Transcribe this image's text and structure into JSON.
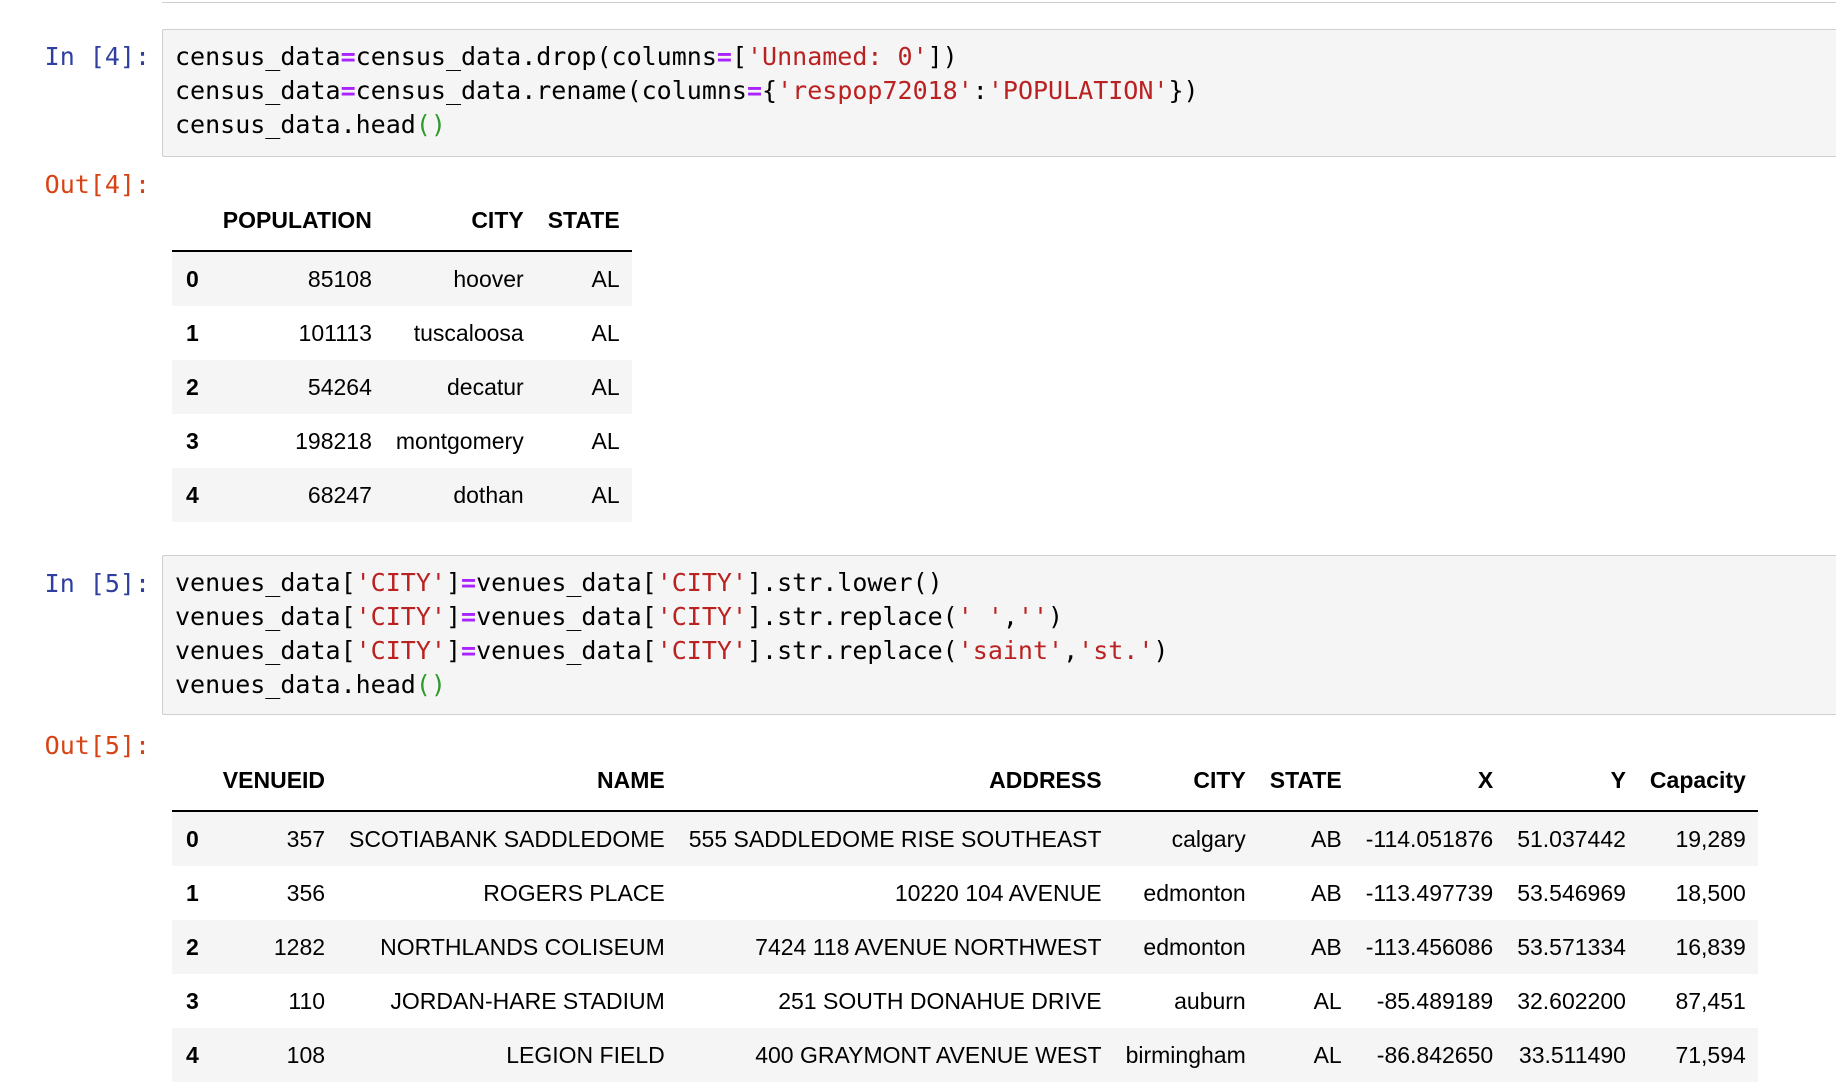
{
  "cell4": {
    "in_prompt": "In [4]:",
    "code": [
      [
        [
          "census_data",
          ""
        ],
        [
          "=",
          "op"
        ],
        [
          "census_data.drop(columns",
          ""
        ],
        [
          "=",
          "op"
        ],
        [
          "[",
          ""
        ],
        [
          "'Unnamed: 0'",
          "str"
        ],
        [
          "])",
          ""
        ]
      ],
      [
        [
          "census_data",
          ""
        ],
        [
          "=",
          "op"
        ],
        [
          "census_data.rename(columns",
          ""
        ],
        [
          "=",
          "op"
        ],
        [
          "{",
          ""
        ],
        [
          "'respop72018'",
          "str"
        ],
        [
          ":",
          ""
        ],
        [
          "'POPULATION'",
          "str"
        ],
        [
          "})",
          ""
        ]
      ],
      [
        [
          "census_data.head",
          ""
        ],
        [
          "()",
          "paren"
        ]
      ]
    ],
    "out_prompt": "Out[4]:",
    "table": {
      "columns": [
        "POPULATION",
        "CITY",
        "STATE"
      ],
      "rows": [
        {
          "index": "0",
          "cells": [
            "85108",
            "hoover",
            "AL"
          ]
        },
        {
          "index": "1",
          "cells": [
            "101113",
            "tuscaloosa",
            "AL"
          ]
        },
        {
          "index": "2",
          "cells": [
            "54264",
            "decatur",
            "AL"
          ]
        },
        {
          "index": "3",
          "cells": [
            "198218",
            "montgomery",
            "AL"
          ]
        },
        {
          "index": "4",
          "cells": [
            "68247",
            "dothan",
            "AL"
          ]
        }
      ]
    }
  },
  "cell5": {
    "in_prompt": "In [5]:",
    "code": [
      [
        [
          "venues_data[",
          ""
        ],
        [
          "'CITY'",
          "str"
        ],
        [
          "]",
          ""
        ],
        [
          "=",
          "op"
        ],
        [
          "venues_data[",
          ""
        ],
        [
          "'CITY'",
          "str"
        ],
        [
          "].str.lower()",
          ""
        ]
      ],
      [
        [
          "venues_data[",
          ""
        ],
        [
          "'CITY'",
          "str"
        ],
        [
          "]",
          ""
        ],
        [
          "=",
          "op"
        ],
        [
          "venues_data[",
          ""
        ],
        [
          "'CITY'",
          "str"
        ],
        [
          "].str.replace(",
          ""
        ],
        [
          "' '",
          "str"
        ],
        [
          ",",
          ""
        ],
        [
          "''",
          "str"
        ],
        [
          ")",
          ""
        ]
      ],
      [
        [
          "venues_data[",
          ""
        ],
        [
          "'CITY'",
          "str"
        ],
        [
          "]",
          ""
        ],
        [
          "=",
          "op"
        ],
        [
          "venues_data[",
          ""
        ],
        [
          "'CITY'",
          "str"
        ],
        [
          "].str.replace(",
          ""
        ],
        [
          "'saint'",
          "str"
        ],
        [
          ",",
          ""
        ],
        [
          "'st.'",
          "str"
        ],
        [
          ")",
          ""
        ]
      ],
      [
        [
          "venues_data.head",
          ""
        ],
        [
          "()",
          "paren"
        ]
      ]
    ],
    "out_prompt": "Out[5]:",
    "table": {
      "columns": [
        "VENUEID",
        "NAME",
        "ADDRESS",
        "CITY",
        "STATE",
        "X",
        "Y",
        "Capacity"
      ],
      "rows": [
        {
          "index": "0",
          "cells": [
            "357",
            "SCOTIABANK SADDLEDOME",
            "555 SADDLEDOME RISE SOUTHEAST",
            "calgary",
            "AB",
            "-114.051876",
            "51.037442",
            "19,289"
          ]
        },
        {
          "index": "1",
          "cells": [
            "356",
            "ROGERS PLACE",
            "10220 104 AVENUE",
            "edmonton",
            "AB",
            "-113.497739",
            "53.546969",
            "18,500"
          ]
        },
        {
          "index": "2",
          "cells": [
            "1282",
            "NORTHLANDS COLISEUM",
            "7424 118 AVENUE NORTHWEST",
            "edmonton",
            "AB",
            "-113.456086",
            "53.571334",
            "16,839"
          ]
        },
        {
          "index": "3",
          "cells": [
            "110",
            "JORDAN-HARE STADIUM",
            "251 SOUTH DONAHUE DRIVE",
            "auburn",
            "AL",
            "-85.489189",
            "32.602200",
            "87,451"
          ]
        },
        {
          "index": "4",
          "cells": [
            "108",
            "LEGION FIELD",
            "400 GRAYMONT AVENUE WEST",
            "birmingham",
            "AL",
            "-86.842650",
            "33.511490",
            "71,594"
          ]
        }
      ]
    }
  }
}
